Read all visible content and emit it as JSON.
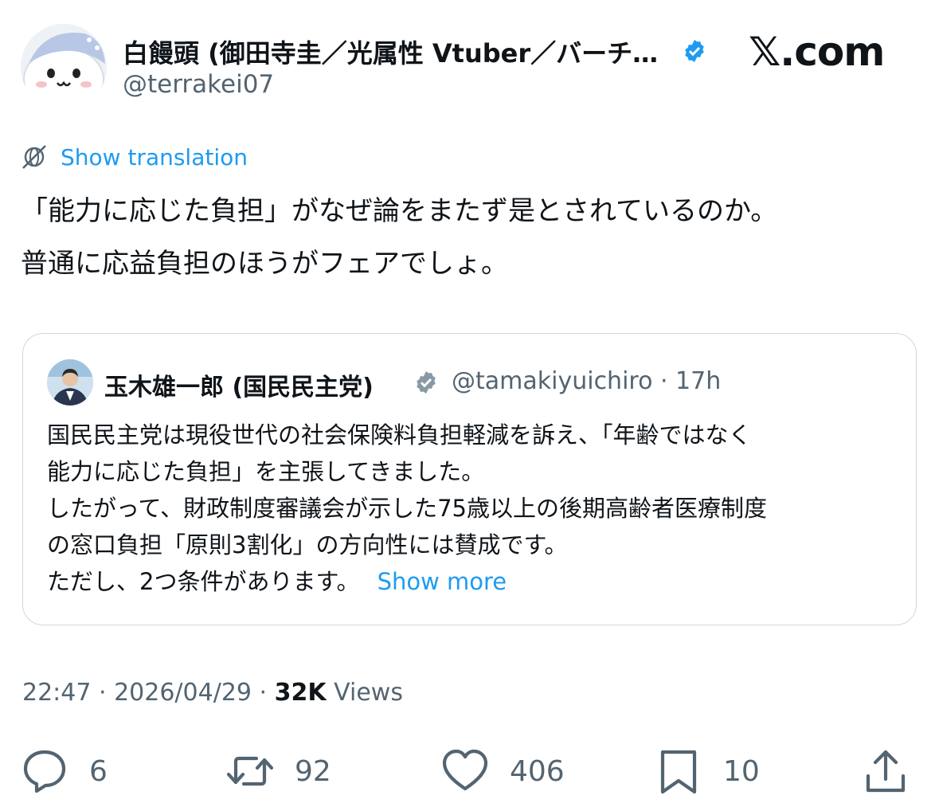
{
  "author": {
    "display_name": "白饅頭 (御田寺圭／光属性 Vtuber／バーチ…",
    "handle": "@terrakei07",
    "verified_color": "#1d9bf0"
  },
  "brand": "𝕏.com",
  "translation": {
    "label": "Show translation",
    "icon": "globe-slash-icon"
  },
  "tweet": {
    "lines": [
      "「能力に応じた負担」がなぜ論をまたず是とされているのか。",
      "普通に応益負担のほうがフェアでしょ。"
    ]
  },
  "quote": {
    "name": "玉木雄一郎 (国民民主党)",
    "handle_time": "@tamakiyuichiro · 17h",
    "verified_color": "#8899a6",
    "lines": [
      "国民民主党は現役世代の社会保険料負担軽減を訴え、「年齢ではなく",
      "能力に応じた負担」を主張してきました。",
      "したがって、財政制度審議会が示した75歳以上の後期高齢者医療制度",
      "の窓口負担「原則3割化」の方向性には賛成です。",
      "ただし、2つ条件があります。"
    ],
    "show_more": "Show more"
  },
  "meta": {
    "time": "22:47",
    "date": "2026/04/29",
    "separator": " · ",
    "views_count": "32K",
    "views_label": "Views"
  },
  "actions": {
    "reply": {
      "icon": "reply-icon",
      "count": "6"
    },
    "retweet": {
      "icon": "retweet-icon",
      "count": "92"
    },
    "like": {
      "icon": "heart-icon",
      "count": "406"
    },
    "bookmark": {
      "icon": "bookmark-icon",
      "count": "10"
    },
    "share": {
      "icon": "share-icon"
    }
  },
  "colors": {
    "accent": "#1d9bf0",
    "secondary_text": "#536471",
    "border": "#cfd9de"
  }
}
